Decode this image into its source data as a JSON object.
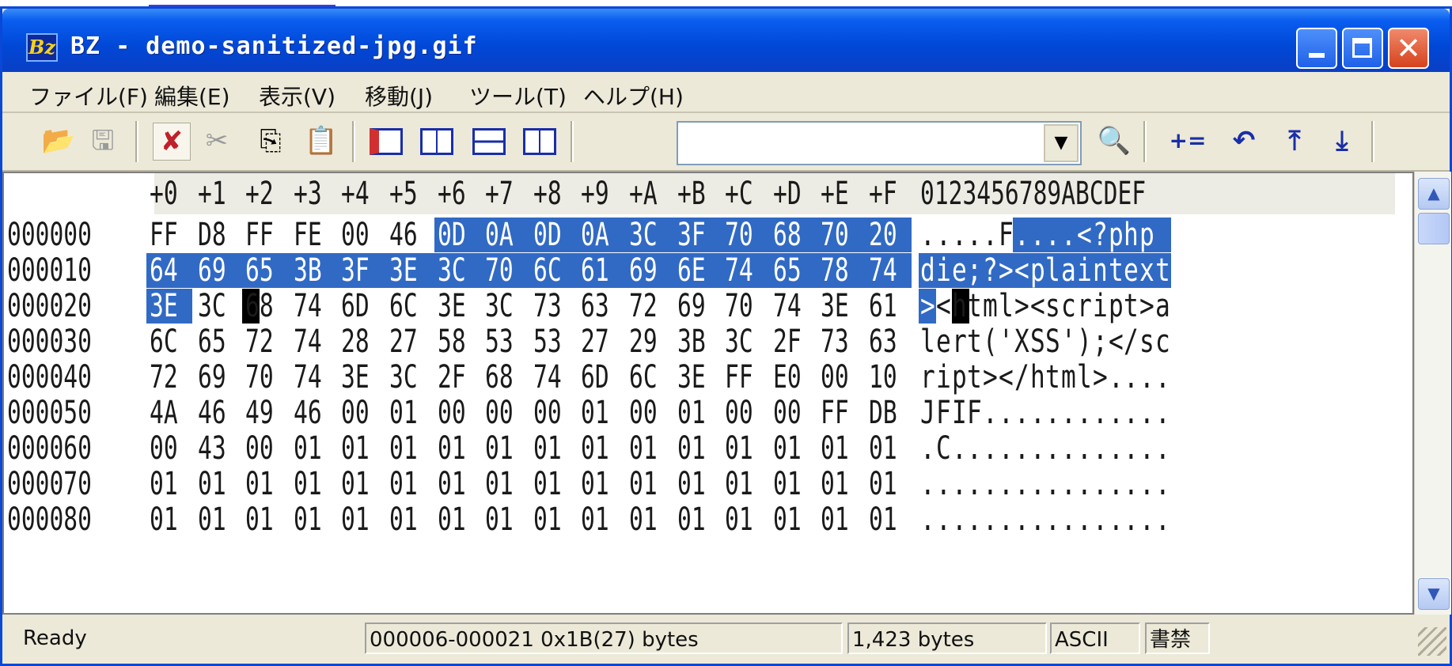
{
  "window": {
    "title": "BZ - demo-sanitized-jpg.gif",
    "app_icon_text": "Bz",
    "close_glyph": "✕"
  },
  "menu": [
    "ファイル(F)",
    "編集(E)",
    "表示(V)",
    "移動(J)",
    "ツール(T)",
    "ヘルプ(H)"
  ],
  "toolbar": {
    "search_value": "",
    "icons": [
      "open-folder-icon",
      "save-icon",
      "delete-icon",
      "cut-icon",
      "copy-icon",
      "paste-icon",
      "single-pane-icon",
      "split-vertical-icon",
      "split-horizontal-icon",
      "compare-pane-icon",
      "binoculars-icon",
      "add-icon",
      "return-icon",
      "jump-top-icon",
      "jump-bottom-icon"
    ],
    "glyphs": {
      "open": "📂",
      "save": "🖫",
      "delete": "✘",
      "cut": "✂",
      "copy": "⎘",
      "paste": "📋",
      "find": "🔍",
      "add": "+=",
      "back": "↶",
      "top": "⤒",
      "bottom": "⤓",
      "dropdown": "▼"
    }
  },
  "hex": {
    "column_headers": [
      "+0",
      "+1",
      "+2",
      "+3",
      "+4",
      "+5",
      "+6",
      "+7",
      "+8",
      "+9",
      "+A",
      "+B",
      "+C",
      "+D",
      "+E",
      "+F"
    ],
    "ascii_header": "0123456789ABCDEF",
    "rows": [
      {
        "addr": "000000",
        "bytes": [
          "FF",
          "D8",
          "FF",
          "FE",
          "00",
          "46",
          "0D",
          "0A",
          "0D",
          "0A",
          "3C",
          "3F",
          "70",
          "68",
          "70",
          "20"
        ],
        "ascii": ".....F....<?php "
      },
      {
        "addr": "000010",
        "bytes": [
          "64",
          "69",
          "65",
          "3B",
          "3F",
          "3E",
          "3C",
          "70",
          "6C",
          "61",
          "69",
          "6E",
          "74",
          "65",
          "78",
          "74"
        ],
        "ascii": "die;?><plaintext"
      },
      {
        "addr": "000020",
        "bytes": [
          "3E",
          "3C",
          "68",
          "74",
          "6D",
          "6C",
          "3E",
          "3C",
          "73",
          "63",
          "72",
          "69",
          "70",
          "74",
          "3E",
          "61"
        ],
        "ascii": "><html><script>a"
      },
      {
        "addr": "000030",
        "bytes": [
          "6C",
          "65",
          "72",
          "74",
          "28",
          "27",
          "58",
          "53",
          "53",
          "27",
          "29",
          "3B",
          "3C",
          "2F",
          "73",
          "63"
        ],
        "ascii": "lert('XSS');</sc"
      },
      {
        "addr": "000040",
        "bytes": [
          "72",
          "69",
          "70",
          "74",
          "3E",
          "3C",
          "2F",
          "68",
          "74",
          "6D",
          "6C",
          "3E",
          "FF",
          "E0",
          "00",
          "10"
        ],
        "ascii": "ript></html>...."
      },
      {
        "addr": "000050",
        "bytes": [
          "4A",
          "46",
          "49",
          "46",
          "00",
          "01",
          "00",
          "00",
          "00",
          "01",
          "00",
          "01",
          "00",
          "00",
          "FF",
          "DB"
        ],
        "ascii": "JFIF............"
      },
      {
        "addr": "000060",
        "bytes": [
          "00",
          "43",
          "00",
          "01",
          "01",
          "01",
          "01",
          "01",
          "01",
          "01",
          "01",
          "01",
          "01",
          "01",
          "01",
          "01"
        ],
        "ascii": ".C.............."
      },
      {
        "addr": "000070",
        "bytes": [
          "01",
          "01",
          "01",
          "01",
          "01",
          "01",
          "01",
          "01",
          "01",
          "01",
          "01",
          "01",
          "01",
          "01",
          "01",
          "01"
        ],
        "ascii": "................"
      },
      {
        "addr": "000080",
        "bytes": [
          "01",
          "01",
          "01",
          "01",
          "01",
          "01",
          "01",
          "01",
          "01",
          "01",
          "01",
          "01",
          "01",
          "01",
          "01",
          "01"
        ],
        "ascii": "................"
      }
    ],
    "selection": {
      "start": 6,
      "end": 32
    },
    "cursor": 33
  },
  "status": {
    "state": "Ready",
    "range": "000006-000021 0x1B(27) bytes",
    "size": "1,423 bytes",
    "encoding": "ASCII",
    "mode": "書禁"
  },
  "colors": {
    "selection": "#316ac5",
    "title_bar": "#0047d6",
    "window_bg": "#ece9d8",
    "cursor": "#000000"
  }
}
